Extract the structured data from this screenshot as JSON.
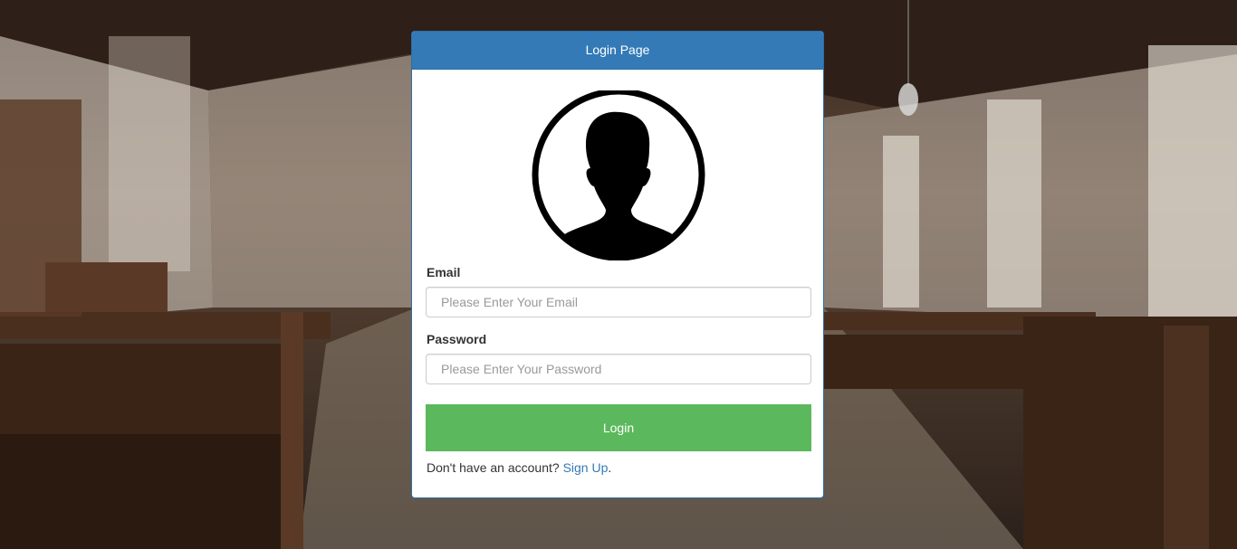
{
  "login_card": {
    "title": "Login Page",
    "email_label": "Email",
    "email_placeholder": "Please Enter Your Email",
    "email_value": "",
    "password_label": "Password",
    "password_placeholder": "Please Enter Your Password",
    "password_value": "",
    "login_button": "Login",
    "signup_prompt": "Don't have an account? ",
    "signup_link": "Sign Up",
    "signup_period": "."
  },
  "icons": {
    "avatar": "user-silhouette-icon"
  },
  "colors": {
    "header": "#337ab7",
    "login_button": "#5cb85c",
    "link": "#337ab7"
  }
}
